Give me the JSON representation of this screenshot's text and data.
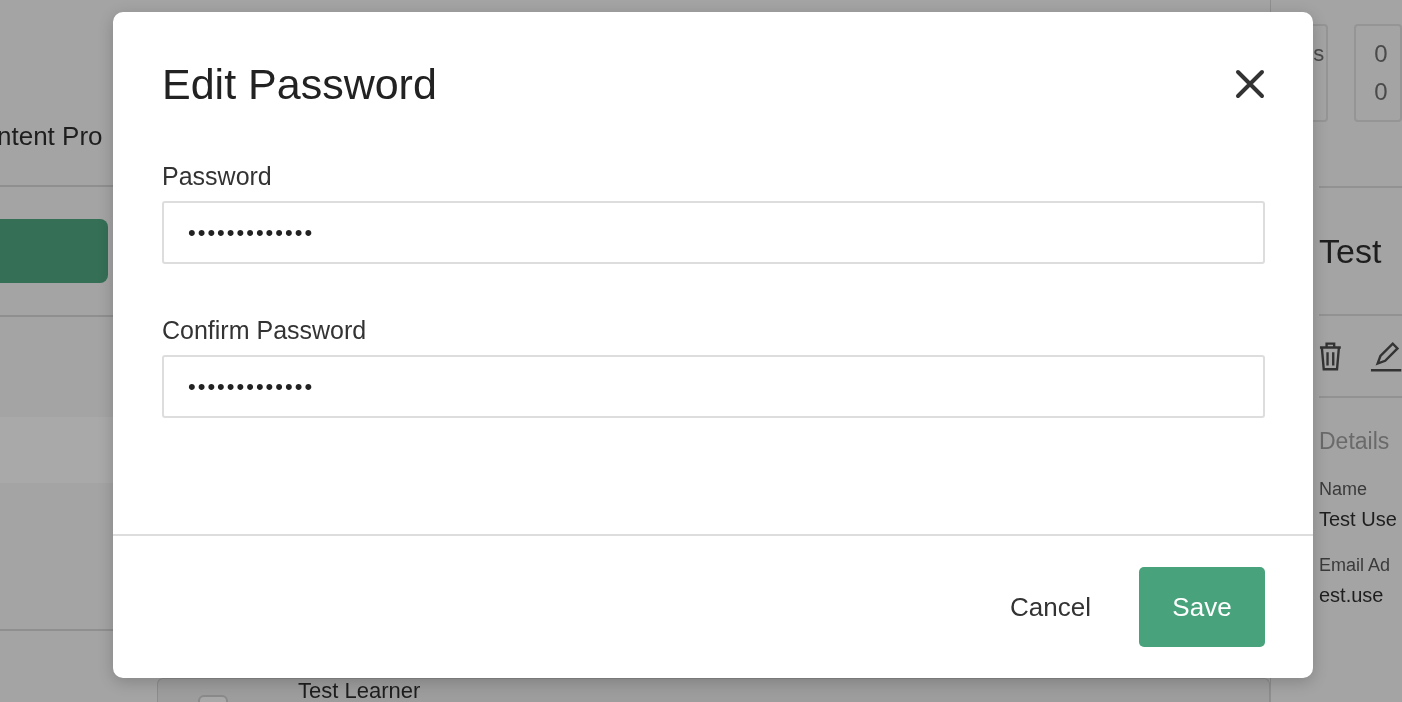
{
  "background": {
    "header_text": "ntent Pro",
    "stats": [
      {
        "line_1": "s"
      },
      {
        "line_1": "0",
        "line_2": "0"
      }
    ],
    "list_row": {
      "name": "Test Learner",
      "checked": false
    },
    "detail": {
      "title": "Test",
      "section": "Details",
      "fields": [
        {
          "label": "Name",
          "value": "Test Use"
        },
        {
          "label": "Email Ad",
          "value": "est.use"
        }
      ]
    }
  },
  "dialog": {
    "title": "Edit Password",
    "fields": [
      {
        "label": "Password",
        "value": "•••••••••••••"
      },
      {
        "label": "Confirm Password",
        "value": "•••••••••••••"
      }
    ],
    "buttons": [
      {
        "label": "Cancel",
        "kind": "text"
      },
      {
        "label": "Save",
        "kind": "primary"
      }
    ]
  }
}
